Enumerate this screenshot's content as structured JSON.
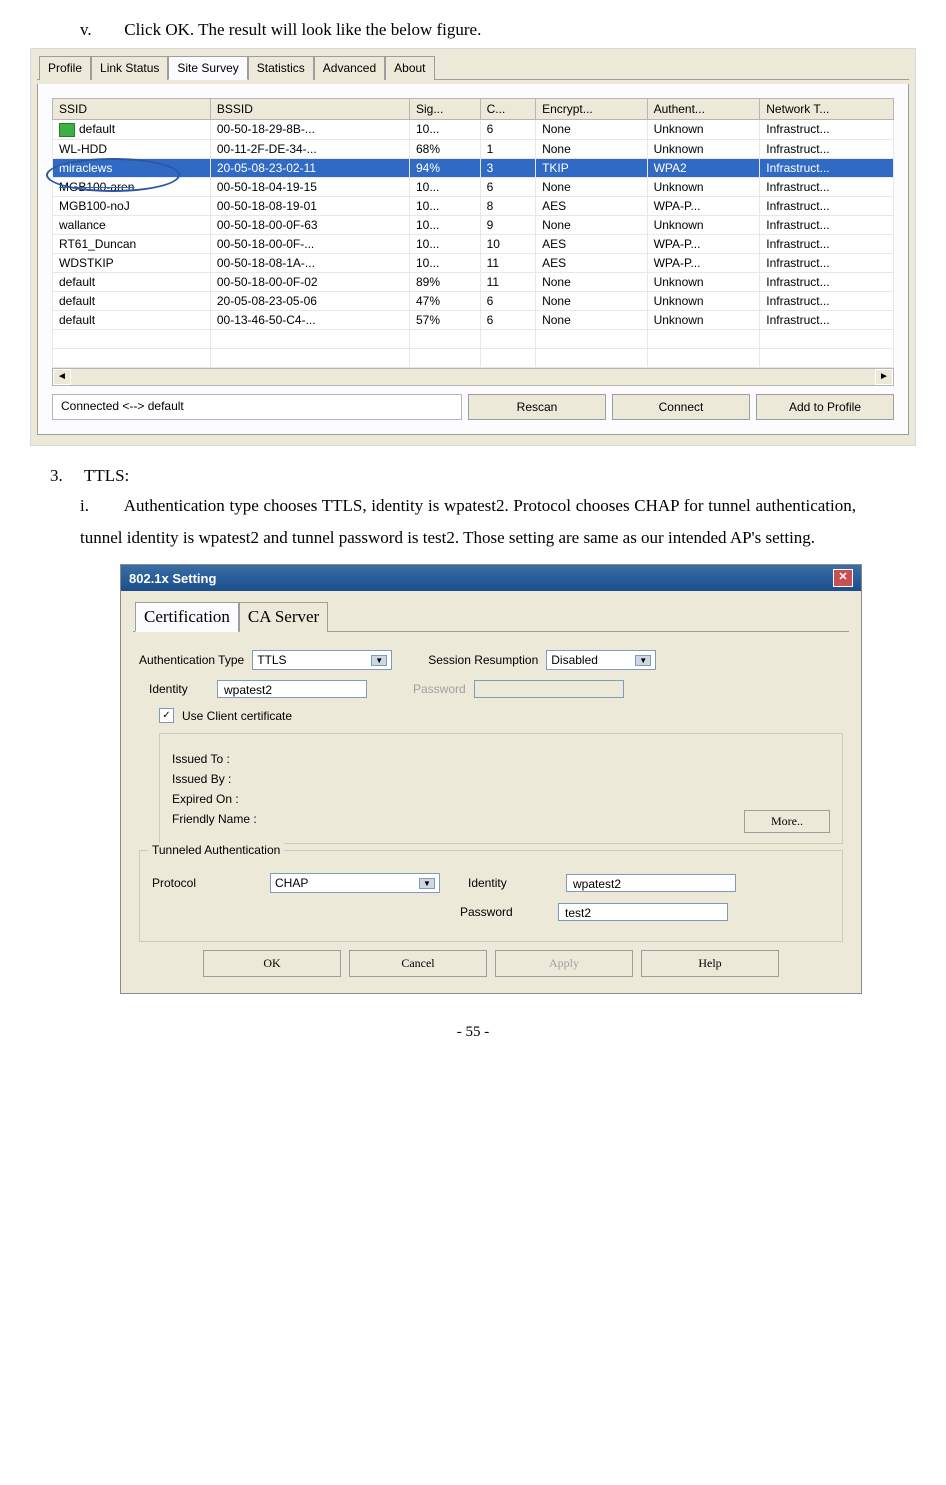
{
  "instr_v": {
    "num": "v.",
    "text": "Click OK. The result will look like the below figure."
  },
  "tabs": [
    "Profile",
    "Link Status",
    "Site Survey",
    "Statistics",
    "Advanced",
    "About"
  ],
  "active_tab_index": 2,
  "columns": [
    "SSID",
    "BSSID",
    "Sig...",
    "C...",
    "Encrypt...",
    "Authent...",
    "Network T..."
  ],
  "rows": [
    {
      "icon": true,
      "ssid": "default",
      "bssid": "00-50-18-29-8B-...",
      "sig": "10...",
      "c": "6",
      "enc": "None",
      "auth": "Unknown",
      "net": "Infrastruct..."
    },
    {
      "ssid": "WL-HDD",
      "bssid": "00-11-2F-DE-34-...",
      "sig": "68%",
      "c": "1",
      "enc": "None",
      "auth": "Unknown",
      "net": "Infrastruct..."
    },
    {
      "selected": true,
      "ssid": "miraclews",
      "bssid": "20-05-08-23-02-11",
      "sig": "94%",
      "c": "3",
      "enc": "TKIP",
      "auth": "WPA2",
      "net": "Infrastruct..."
    },
    {
      "strike": true,
      "ssid": "MGB100-aren",
      "bssid": "00-50-18-04-19-15",
      "sig": "10...",
      "c": "6",
      "enc": "None",
      "auth": "Unknown",
      "net": "Infrastruct..."
    },
    {
      "ssid": "MGB100-noJ",
      "bssid": "00-50-18-08-19-01",
      "sig": "10...",
      "c": "8",
      "enc": "AES",
      "auth": "WPA-P...",
      "net": "Infrastruct..."
    },
    {
      "ssid": "wallance",
      "bssid": "00-50-18-00-0F-63",
      "sig": "10...",
      "c": "9",
      "enc": "None",
      "auth": "Unknown",
      "net": "Infrastruct..."
    },
    {
      "ssid": "RT61_Duncan",
      "bssid": "00-50-18-00-0F-...",
      "sig": "10...",
      "c": "10",
      "enc": "AES",
      "auth": "WPA-P...",
      "net": "Infrastruct..."
    },
    {
      "ssid": "WDSTKIP",
      "bssid": "00-50-18-08-1A-...",
      "sig": "10...",
      "c": "11",
      "enc": "AES",
      "auth": "WPA-P...",
      "net": "Infrastruct..."
    },
    {
      "ssid": "default",
      "bssid": "00-50-18-00-0F-02",
      "sig": "89%",
      "c": "11",
      "enc": "None",
      "auth": "Unknown",
      "net": "Infrastruct..."
    },
    {
      "ssid": "default",
      "bssid": "20-05-08-23-05-06",
      "sig": "47%",
      "c": "6",
      "enc": "None",
      "auth": "Unknown",
      "net": "Infrastruct..."
    },
    {
      "ssid": "default",
      "bssid": "00-13-46-50-C4-...",
      "sig": "57%",
      "c": "6",
      "enc": "None",
      "auth": "Unknown",
      "net": "Infrastruct..."
    }
  ],
  "status_text": "Connected <--> default",
  "site_buttons": [
    "Rescan",
    "Connect",
    "Add to Profile"
  ],
  "step3": {
    "num": "3.",
    "title": "TTLS:"
  },
  "step3i": {
    "num": "i.",
    "text": "Authentication type chooses TTLS, identity is wpatest2. Protocol chooses CHAP for tunnel authentication, tunnel identity is wpatest2 and tunnel password is test2. Those setting are same as our intended AP's setting."
  },
  "dialog": {
    "title": "802.1x Setting",
    "tabs": [
      "Certification",
      "CA Server"
    ],
    "active_tab": 0,
    "auth_type_label": "Authentication Type",
    "auth_type_value": "TTLS",
    "session_label": "Session Resumption",
    "session_value": "Disabled",
    "identity_label": "Identity",
    "identity_value": "wpatest2",
    "password_label": "Password",
    "use_client_cert_label": "Use Client certificate",
    "use_client_cert_checked": true,
    "cert_fields": [
      "Issued To :",
      "Issued By :",
      "Expired On :",
      "Friendly Name :"
    ],
    "more_button": "More..",
    "tunnel_legend": "Tunneled Authentication",
    "tunnel_protocol_label": "Protocol",
    "tunnel_protocol_value": "CHAP",
    "tunnel_identity_label": "Identity",
    "tunnel_identity_value": "wpatest2",
    "tunnel_password_label": "Password",
    "tunnel_password_value": "test2",
    "buttons": [
      "OK",
      "Cancel",
      "Apply",
      "Help"
    ]
  },
  "page_number": "- 55 -"
}
